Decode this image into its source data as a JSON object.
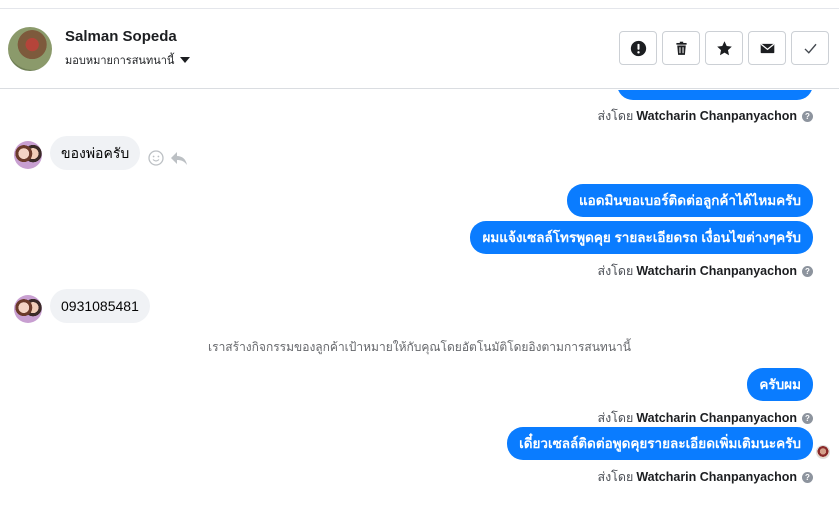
{
  "header": {
    "contact_name": "Salman Sopeda",
    "assign_label": "มอบหมายการสนทนานี้"
  },
  "actions": [
    {
      "name": "mark-spam-button",
      "icon": "exclamation-icon"
    },
    {
      "name": "delete-button",
      "icon": "trash-icon"
    },
    {
      "name": "star-button",
      "icon": "star-icon"
    },
    {
      "name": "mark-unread-button",
      "icon": "envelope-icon"
    },
    {
      "name": "mark-done-button",
      "icon": "checkmark-icon"
    }
  ],
  "messages": {
    "sent_by_label": "ส่งโดย",
    "sender_name": "Watcharin Chanpanyachon",
    "incoming_1": "ของพ่อครับ",
    "outgoing_1": "แอดมินขอเบอร์ติดต่อลูกค้าได้ไหมครับ",
    "outgoing_2": "ผมแจ้งเซลล์โทรพูดคุย รายละเอียดรถ เงื่อนไขต่างๆครับ",
    "incoming_2": "0931085481",
    "system_note": "เราสร้างกิจกรรมของลูกค้าเป้าหมายให้กับคุณโดยอัตโนมัติโดยอิงตามการสนทนานี้",
    "outgoing_3": "ครับผม",
    "outgoing_4": "เดี๋ยวเซลล์ติดต่อพูดคุยรายละเอียดเพิ่มเติมนะครับ"
  },
  "colors": {
    "outgoing_bubble": "#0a7cff",
    "incoming_bubble": "#f0f2f5"
  }
}
